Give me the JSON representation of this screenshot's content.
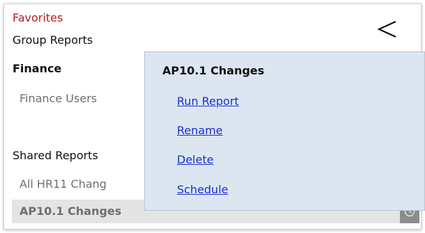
{
  "sidebar": {
    "favorites_label": "Favorites",
    "group_reports_label": "Group Reports",
    "finance_label": "Finance",
    "finance_users_label": "Finance Users",
    "shared_reports_label": "Shared Reports",
    "hr11_label": "All HR11 Chang",
    "selected_report_label": "AP10.1 Changes",
    "selected_report_icon": "clock-icon",
    "back_icon": "chevron-left-icon"
  },
  "context_menu": {
    "title": "AP10.1 Changes",
    "items": [
      "Run Report",
      "Rename",
      "Delete",
      "Schedule"
    ]
  },
  "colors": {
    "favorites_text": "#b01e23",
    "menu_background": "#dce6f1",
    "link_color": "#1b2fd4",
    "selected_row": "#e4e4e4"
  }
}
